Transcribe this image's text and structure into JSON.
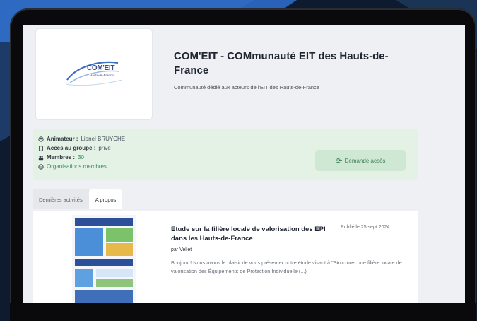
{
  "community": {
    "logo_text": "COM'EIT",
    "logo_subtext": "Hauts-de-France",
    "title": "COM'EIT - COMmunauté EIT des Hauts-de-France",
    "description": "Communauté dédié aux acteurs de l'EIT des Hauts-de-France"
  },
  "info": {
    "animator_label": "Animateur :",
    "animator_value": "Lionel BRUYCHE",
    "access_label": "Accès au groupe :",
    "access_value": "privé",
    "members_label": "Membres :",
    "members_value": "30",
    "organisations_label": "Organisations membres",
    "request_access_label": "Demande accès"
  },
  "tabs": [
    {
      "label": "Dernières activités"
    },
    {
      "label": "A propos"
    }
  ],
  "article": {
    "title": "Etude sur la filière locale de valorisation des EPI dans les Hauts-de-France",
    "published": "Publié le 25 sept 2024",
    "by_prefix": "par",
    "author": "Vellet",
    "excerpt": "Bonjour ! Nous avons le plaisir de vous présenter notre étude visant à \"Structurer une filière locale de valorisation des Équipements de Protection Individuelle (...)"
  },
  "colors": {
    "info_background": "#e4f1e5",
    "button_background": "#cfe8d3",
    "accent_green": "#3f8a5d",
    "logo_blue": "#3a4f86"
  },
  "icons": {
    "animator": "user-circle-icon",
    "access": "document-icon",
    "members": "users-icon",
    "organisations": "globe-icon",
    "request_access": "user-plus-icon"
  }
}
